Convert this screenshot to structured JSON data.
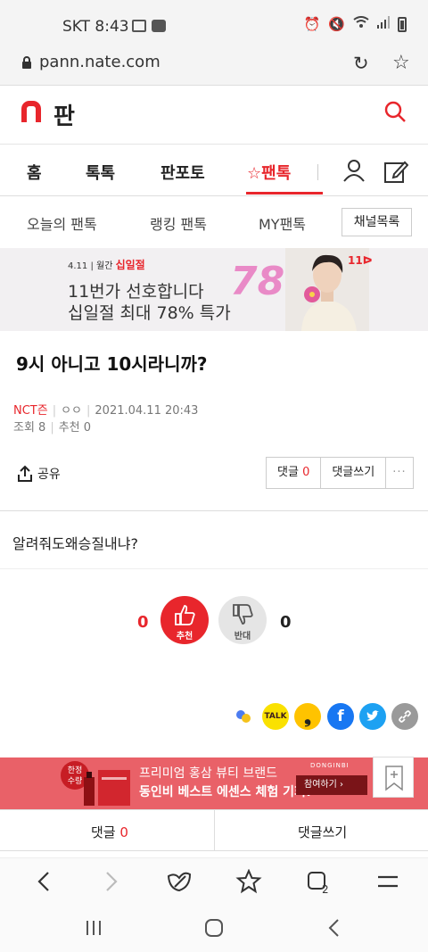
{
  "status": {
    "carrier_time": "SKT 8:43"
  },
  "browser": {
    "url": "pann.nate.com"
  },
  "site": {
    "logo_text": "판"
  },
  "main_nav": [
    "홈",
    "톡톡",
    "판포토",
    "☆팬톡"
  ],
  "sub_nav": [
    "오늘의 팬톡",
    "랭킹 팬톡",
    "MY팬톡"
  ],
  "channel_button": "채널목록",
  "banner": {
    "date": "4.11",
    "tag": "월간",
    "event": "십일절",
    "line1": "11번가 선호합니다",
    "line2": "십일절 최대 78% 특가",
    "percent": "78%",
    "brand": "11ᐅ"
  },
  "article": {
    "title": "9시 아니고 10시라니까?",
    "category": "NCT즌",
    "author": "ㅇㅇ",
    "date": "2021.04.11 20:43",
    "views_label": "조회 8",
    "recommend_label": "추천 0",
    "share_label": "공유",
    "comment_label": "댓글",
    "comment_count": "0",
    "write_comment_label": "댓글쓰기",
    "more_label": "···",
    "body": "알려줘도왜승질내냐?"
  },
  "votes": {
    "up_count": "0",
    "up_label": "추천",
    "down_count": "0",
    "down_label": "반대"
  },
  "social": {
    "kakaotalk_label": "TALK"
  },
  "ad2": {
    "badge": "한정\n수량",
    "line1": "프리미엄 홍삼 뷰티 브랜드",
    "line2": "동인비 베스트 에센스 체험 기회!",
    "brand": "DONGINBI",
    "button": "참여하기 ›"
  },
  "bottom_tabs": {
    "comment_label": "댓글",
    "comment_count": "0",
    "write_label": "댓글쓰기"
  },
  "colors": {
    "accent": "#e8262c",
    "ad_bg": "#e96168"
  }
}
